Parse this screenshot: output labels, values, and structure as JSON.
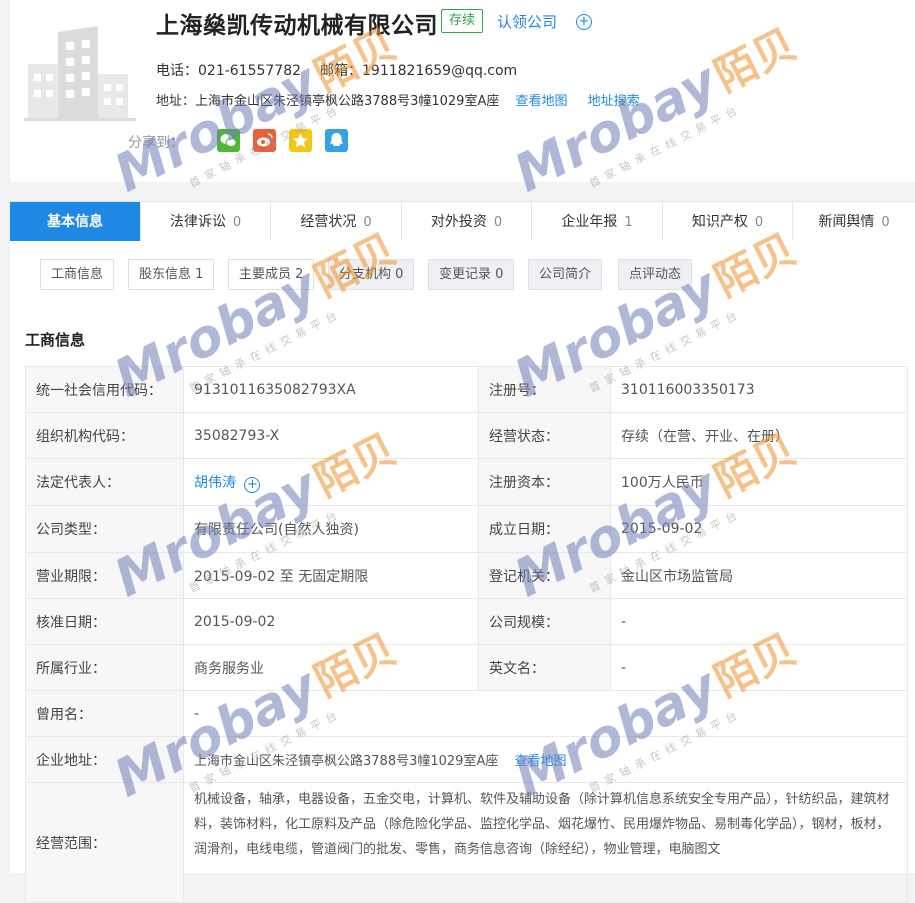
{
  "company": {
    "name": "上海燊凯传动机械有限公司",
    "status": "存续",
    "claim": "认领公司",
    "phone_label": "电话：",
    "phone": "021-61557782",
    "email_label": "邮箱：",
    "email": "1911821659@qq.com",
    "address_label": "地址：",
    "address": "上海市金山区朱泾镇亭枫公路3788号3幢1029室A座",
    "view_map": "查看地图",
    "addr_search": "地址搜索",
    "share_label": "分享到：",
    "share_icons": [
      "wechat-icon",
      "weibo-icon",
      "qzone-icon",
      "qq-icon"
    ]
  },
  "tabs": [
    {
      "label": "基本信息",
      "count": ""
    },
    {
      "label": "法律诉讼",
      "count": "0"
    },
    {
      "label": "经营状况",
      "count": "0"
    },
    {
      "label": "对外投资",
      "count": "0"
    },
    {
      "label": "企业年报",
      "count": "1"
    },
    {
      "label": "知识产权",
      "count": "0"
    },
    {
      "label": "新闻舆情",
      "count": "0"
    }
  ],
  "subtabs": [
    {
      "label": "工商信息"
    },
    {
      "label": "股东信息 1"
    },
    {
      "label": "主要成员 2"
    },
    {
      "label": "分支机构 0"
    },
    {
      "label": "变更记录 0"
    },
    {
      "label": "公司简介"
    },
    {
      "label": "点评动态"
    }
  ],
  "section_title": "工商信息",
  "info": {
    "credit_code_label": "统一社会信用代码：",
    "credit_code": "9131011635082793XA",
    "reg_no_label": "注册号：",
    "reg_no": "310116003350173",
    "org_code_label": "组织机构代码：",
    "org_code": "35082793-X",
    "op_status_label": "经营状态：",
    "op_status": "存续（在营、开业、在册）",
    "legal_rep_label": "法定代表人：",
    "legal_rep": "胡伟涛",
    "reg_capital_label": "注册资本：",
    "reg_capital": "100万人民币",
    "type_label": "公司类型：",
    "type": "有限责任公司(自然人独资)",
    "founded_label": "成立日期：",
    "founded": "2015-09-02",
    "term_label": "营业期限：",
    "term": "2015-09-02 至 无固定期限",
    "authority_label": "登记机关：",
    "authority": "金山区市场监管局",
    "approve_label": "核准日期：",
    "approve": "2015-09-02",
    "scale_label": "公司规模：",
    "scale": "-",
    "industry_label": "所属行业：",
    "industry": "商务服务业",
    "english_label": "英文名：",
    "english": "-",
    "former_label": "曾用名：",
    "former": "-",
    "address_label": "企业地址：",
    "address": "上海市金山区朱泾镇亭枫公路3788号3幢1029室A座",
    "view_map": "查看地图",
    "scope_label": "经营范围：",
    "scope": "机械设备，轴承，电器设备，五金交电，计算机、软件及辅助设备（除计算机信息系统安全专用产品），针纺织品，建筑材料，装饰材料，化工原料及产品（除危险化学品、监控化学品、烟花爆竹、民用爆炸物品、易制毒化学品），钢材，板材，润滑剂，电线电缆，管道阀门的批发、零售，商务信息咨询（除经纪），物业管理，电脑图文"
  },
  "watermark": {
    "brand": "Mrobay",
    "brand_cn": "陌贝",
    "tagline": "首家轴承在线交易平台"
  },
  "colors": {
    "accent": "#1f88e5",
    "status": "#2da44e",
    "wm_blue": "#6f7fb8",
    "wm_orange": "#f0922e"
  }
}
